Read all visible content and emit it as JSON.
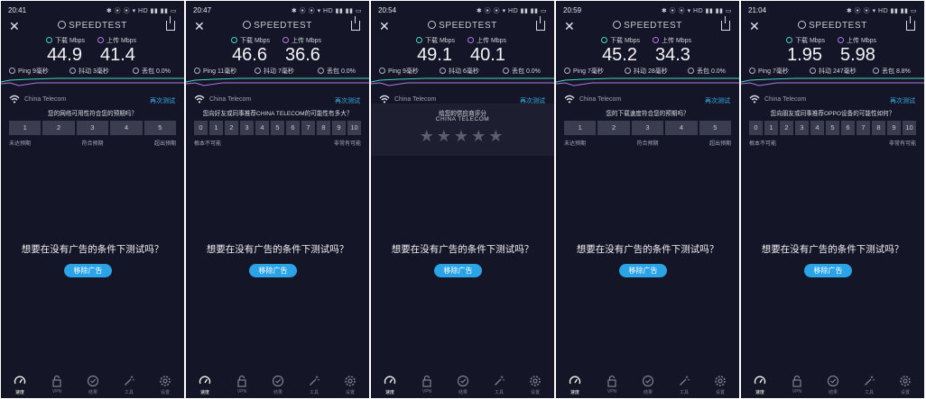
{
  "app": {
    "brand": "SPEEDTEST",
    "download_label": "下载 Mbps",
    "upload_label": "上传 Mbps",
    "ping_label": "Ping",
    "jitter_label": "抖动",
    "loss_label": "丢包",
    "retest_label": "再次测试",
    "ad_question": "想要在没有广告的条件下测试吗？",
    "remove_ads": "移除广告"
  },
  "nav": [
    "速度",
    "VPN",
    "结果",
    "工具",
    "设置"
  ],
  "panels": [
    {
      "time": "20:41",
      "status_icons": "✱ ⦿ ⦿ ▾ HD ▮▮ ▮▮ ▭",
      "download": "44.9",
      "upload": "41.4",
      "ping": "9毫秒",
      "jitter": "3毫秒",
      "loss": "0.0%",
      "isp": "China Telecom",
      "survey": {
        "type": "scale",
        "question": "您的网络可用性符合您的预期吗？",
        "cells": [
          "1",
          "2",
          "3",
          "4",
          "5"
        ],
        "left": "未达预期",
        "mid": "符合预期",
        "right": "超出预期"
      }
    },
    {
      "time": "20:47",
      "status_icons": "✱ ⦿ ⦿ ▾ HD ▮▮ ▮▮ ▭",
      "download": "46.6",
      "upload": "36.6",
      "ping": "11毫秒",
      "jitter": "7毫秒",
      "loss": "0.0%",
      "isp": "China Telecom",
      "survey": {
        "type": "scale",
        "question": "您向好友或同事推荐CHINA TELECOM的可能性有多大？",
        "cells": [
          "0",
          "1",
          "2",
          "3",
          "4",
          "5",
          "6",
          "7",
          "8",
          "9",
          "10"
        ],
        "left": "根本不可能",
        "mid": "",
        "right": "非常有可能"
      }
    },
    {
      "time": "20:54",
      "status_icons": "✱ ⦿ ⦿ ▾ HD ▮▮ ▮▮ ▭",
      "download": "49.1",
      "upload": "40.1",
      "ping": "9毫秒",
      "jitter": "6毫秒",
      "loss": "0.0%",
      "isp": "China Telecom",
      "survey": {
        "type": "stars",
        "question": "给您的供应商评分",
        "sub": "CHINA TELECOM",
        "stars": "★★★★★"
      }
    },
    {
      "time": "20:59",
      "status_icons": "✱ ⦿ ⦿ ▾ HD ▮▮ ▮▮ ▭",
      "download": "45.2",
      "upload": "34.3",
      "ping": "7毫秒",
      "jitter": "28毫秒",
      "loss": "0.0%",
      "isp": "China Telecom",
      "survey": {
        "type": "scale",
        "question": "您的下载速度符合您的预期吗？",
        "cells": [
          "1",
          "2",
          "3",
          "4",
          "5"
        ],
        "left": "未达预期",
        "mid": "符合预期",
        "right": "超出预期"
      }
    },
    {
      "time": "21:04",
      "status_icons": "✱ ⦿ ⦿ ▾ HD ▮▮ ▮▮ ▭",
      "download": "1.95",
      "upload": "5.98",
      "ping": "7毫秒",
      "jitter": "247毫秒",
      "loss": "8.8%",
      "isp": "China Telecom",
      "survey": {
        "type": "scale",
        "question": "您向朋友或同事推荐OPPO设备的可能性如何？",
        "cells": [
          "0",
          "1",
          "2",
          "3",
          "4",
          "5",
          "6",
          "7",
          "8",
          "9",
          "10"
        ],
        "left": "根本不可能",
        "mid": "",
        "right": "非常有可能"
      }
    }
  ],
  "colors": {
    "background": "#141526",
    "download": "#45d6c0",
    "upload": "#b477e4",
    "accent": "#2aa4e6",
    "link": "#3ab0e8"
  }
}
